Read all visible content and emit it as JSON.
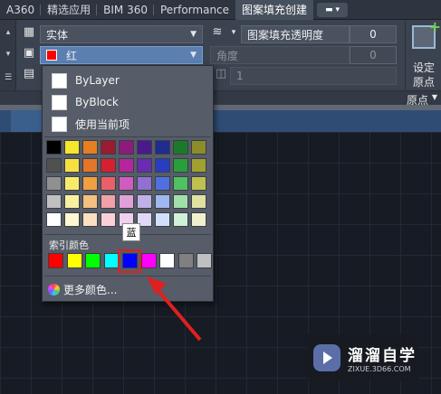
{
  "tabs": [
    {
      "label": "A360"
    },
    {
      "label": "精选应用"
    },
    {
      "label": "BIM 360"
    },
    {
      "label": "Performance"
    },
    {
      "label": "图案填充创建"
    }
  ],
  "ribbon": {
    "pattern_combo": {
      "value": "实体"
    },
    "color_combo": {
      "value": "红",
      "swatch": "#ff0000"
    },
    "transparency": {
      "label": "图案填充透明度",
      "value": "0"
    },
    "angle": {
      "label": "角度",
      "value": "0"
    },
    "scale": {
      "value": "1"
    },
    "origin": {
      "label_line1": "设定",
      "label_line2": "原点",
      "panel_label": "原点"
    }
  },
  "dropdown": {
    "items": [
      {
        "label": "ByLayer"
      },
      {
        "label": "ByBlock"
      },
      {
        "label": "使用当前项"
      }
    ],
    "standard_colors": [
      [
        "#000000",
        "#f7e62a",
        "#e67e22",
        "#9b1c2e",
        "#8e1a7e",
        "#4a1a8c",
        "#1f2d8f",
        "#1b7a2a",
        "#8c8c2a"
      ],
      [
        "#505050",
        "#f5e042",
        "#e4762a",
        "#d62030",
        "#b5269e",
        "#6a2cb0",
        "#2a3cc0",
        "#2a9e3a",
        "#a0a030"
      ],
      [
        "#909090",
        "#f7ec6a",
        "#f0a040",
        "#e8606a",
        "#d05cc0",
        "#9070d0",
        "#5070e0",
        "#50c060",
        "#c0c050"
      ],
      [
        "#c0c0c0",
        "#f8f0a0",
        "#f4c080",
        "#f0a0a8",
        "#e0a0d8",
        "#c0b0e8",
        "#a0b8f0",
        "#a0e0a8",
        "#e0e0a0"
      ],
      [
        "#ffffff",
        "#fff8d0",
        "#fbe0c0",
        "#fad0d8",
        "#f0d0ec",
        "#e0d8f4",
        "#d0e0fc",
        "#d0f0d8",
        "#f0f0d0"
      ]
    ],
    "index_title": "索引颜色",
    "index_colors": [
      "#ff0000",
      "#ffff00",
      "#00ff00",
      "#00ffff",
      "#0000ff",
      "#ff00ff",
      "#ffffff",
      "#808080",
      "#c0c0c0"
    ],
    "tooltip": "蓝",
    "more_colors": "更多颜色..."
  },
  "colors": {
    "highlight": "#e02020",
    "selected_combo": "#5a7fb0"
  },
  "watermark": {
    "title": "溜溜自学",
    "url": "ZIXUE.3D66.COM"
  }
}
